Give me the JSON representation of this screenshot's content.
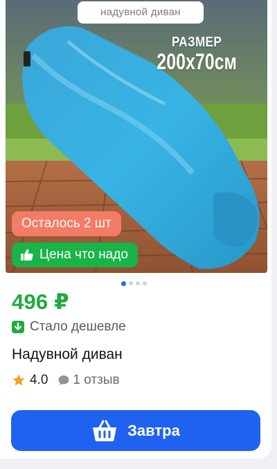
{
  "product": {
    "image_caption": "надувной диван",
    "size_label_line1": "РАЗМЕР",
    "size_label_line2": "200х70см",
    "stock_badge": "Осталось 2 шт",
    "price_badge": "Цена что надо",
    "carousel": {
      "total": 4,
      "active_index": 0
    },
    "price": "496 ₽",
    "price_note": "Стало дешевле",
    "title": "Надувной диван",
    "rating": "4.0",
    "reviews": "1 отзыв",
    "button_label": "Завтра"
  },
  "colors": {
    "accent_blue": "#1f62f0",
    "price_green": "#1faa3f",
    "stock_badge": "#f47b66",
    "price_badge": "#19b347"
  },
  "icons": [
    "thumbs-up-icon",
    "arrow-down-icon",
    "star-icon",
    "comment-icon",
    "basket-icon"
  ]
}
